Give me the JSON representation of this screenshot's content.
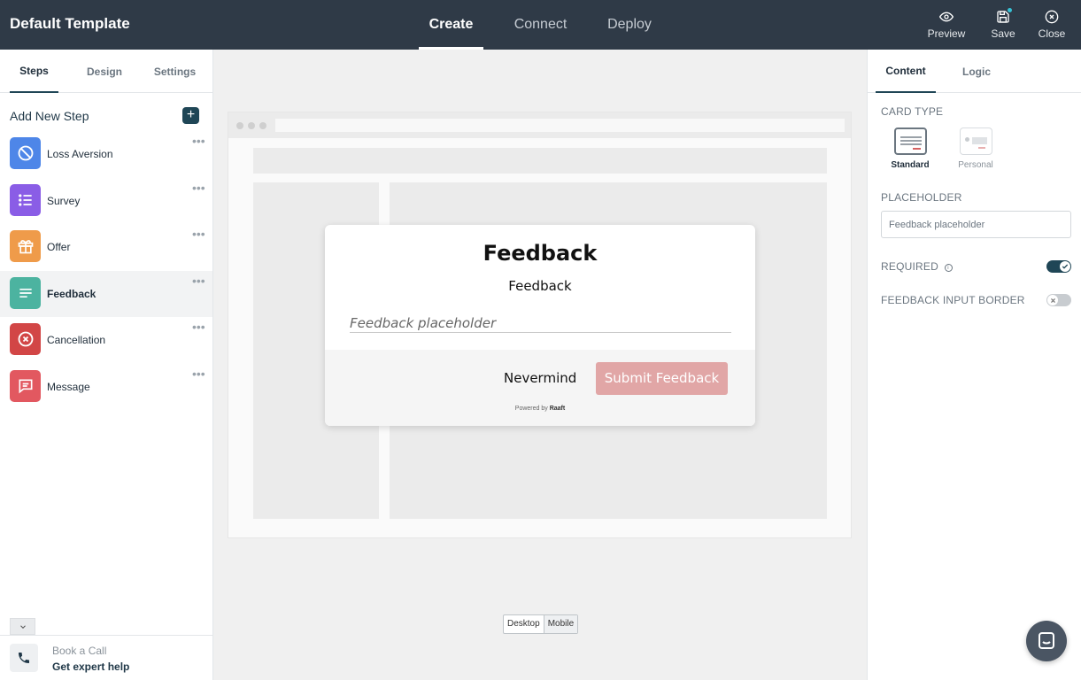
{
  "app": {
    "title": "Default Template"
  },
  "top_tabs": [
    {
      "label": "Create"
    },
    {
      "label": "Connect"
    },
    {
      "label": "Deploy"
    }
  ],
  "top_actions": {
    "preview": "Preview",
    "save": "Save",
    "close": "Close"
  },
  "sidebar": {
    "tabs": [
      {
        "label": "Steps"
      },
      {
        "label": "Design"
      },
      {
        "label": "Settings"
      }
    ],
    "add_step_label": "Add New Step",
    "add_symbol": "+",
    "more_symbol": "•••",
    "steps": [
      {
        "label": "Loss Aversion",
        "color": "#4e86e8",
        "icon": "ban-icon"
      },
      {
        "label": "Survey",
        "color": "#8a5de6",
        "icon": "list-icon"
      },
      {
        "label": "Offer",
        "color": "#ef9b4a",
        "icon": "gift-icon"
      },
      {
        "label": "Feedback",
        "color": "#4cb3a0",
        "icon": "text-lines-icon"
      },
      {
        "label": "Cancellation",
        "color": "#d24646",
        "icon": "x-circle-icon"
      },
      {
        "label": "Message",
        "color": "#e25860",
        "icon": "chat-bubble-icon"
      }
    ],
    "book_call": {
      "title": "Book a Call",
      "subtitle": "Get expert help"
    }
  },
  "preview": {
    "modal": {
      "title": "Feedback",
      "subtitle": "Feedback",
      "input_placeholder": "Feedback placeholder",
      "secondary_button": "Nevermind",
      "primary_button": "Submit Feedback",
      "powered_by": "Powered by",
      "brand": "Raaft",
      "submit_color": "#e1a6a6"
    },
    "device_toggle": [
      "Desktop",
      "Mobile"
    ]
  },
  "right_panel": {
    "tabs": [
      {
        "label": "Content"
      },
      {
        "label": "Logic"
      }
    ],
    "card_type_label": "CARD TYPE",
    "card_types": [
      {
        "label": "Standard",
        "selected": true
      },
      {
        "label": "Personal",
        "selected": false
      }
    ],
    "placeholder_label": "PLACEHOLDER",
    "placeholder_value": "Feedback placeholder",
    "required_label": "REQUIRED",
    "required_on": true,
    "feedback_border_label": "FEEDBACK INPUT BORDER",
    "feedback_border_on": false
  },
  "colors": {
    "topbar": "#2f3a47",
    "accent": "#1f4656"
  }
}
